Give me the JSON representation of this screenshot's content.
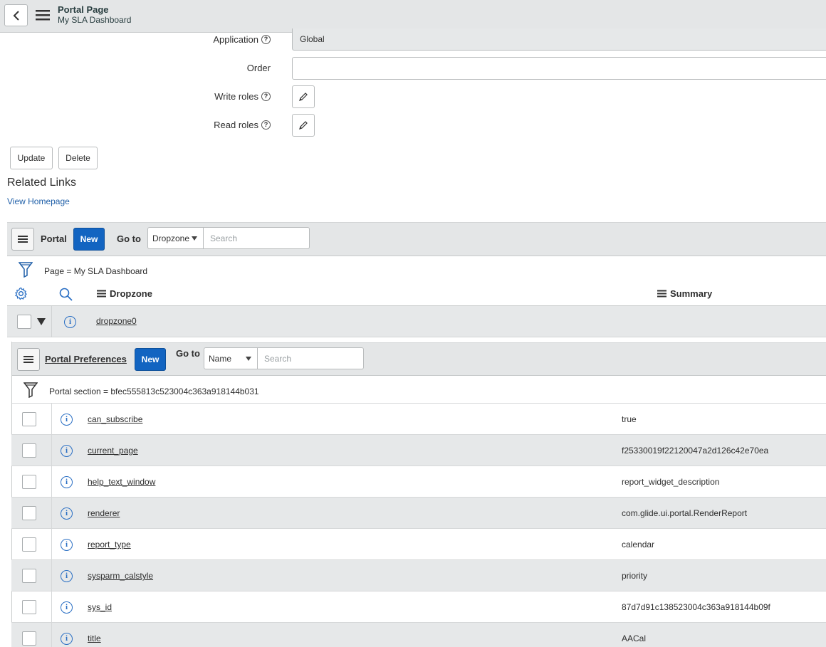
{
  "header": {
    "title": "Portal Page",
    "subtitle": "My SLA Dashboard"
  },
  "form": {
    "application_label": "Application",
    "application_value": "Global",
    "order_label": "Order",
    "order_value": "",
    "write_roles_label": "Write roles",
    "read_roles_label": "Read roles",
    "help_glyph": "?"
  },
  "actions": {
    "update_label": "Update",
    "delete_label": "Delete"
  },
  "related_links": {
    "title": "Related Links",
    "view_homepage": "View Homepage"
  },
  "portal_list": {
    "title": "Portal",
    "new_label": "New",
    "goto_label": "Go to",
    "goto_field": "Dropzone",
    "search_placeholder": "Search",
    "filter_text": "Page = My SLA Dashboard",
    "columns": [
      "Dropzone",
      "Summary"
    ],
    "row": {
      "dropzone": "dropzone0",
      "summary": ""
    }
  },
  "prefs_list": {
    "title": "Portal Preferences",
    "new_label": "New",
    "goto_label": "Go to",
    "goto_field": "Name",
    "search_placeholder": "Search",
    "filter_text": "Portal section = bfec555813c523004c363a918144b031",
    "rows": [
      {
        "name": "can_subscribe",
        "value": "true"
      },
      {
        "name": "current_page",
        "value": "f25330019f22120047a2d126c42e70ea"
      },
      {
        "name": "help_text_window",
        "value": "report_widget_description"
      },
      {
        "name": "renderer",
        "value": "com.glide.ui.portal.RenderReport"
      },
      {
        "name": "report_type",
        "value": "calendar"
      },
      {
        "name": "sysparm_calstyle",
        "value": "priority"
      },
      {
        "name": "sys_id",
        "value": "87d7d91c138523004c363a918144b09f"
      },
      {
        "name": "title",
        "value": "AACal"
      }
    ]
  },
  "icons": {
    "back": "chevron-left-icon",
    "menu": "hamburger-menu-icon",
    "help": "help-circle-icon",
    "pencil": "pencil-icon",
    "filter": "funnel-icon",
    "settings": "gear-icon",
    "search": "magnifier-icon",
    "expand": "triangle-down-icon",
    "info": "info-circle-icon"
  },
  "colors": {
    "primary_button": "#1264c1",
    "link": "#1f5fa8",
    "header_bg": "#e4e6e7"
  }
}
